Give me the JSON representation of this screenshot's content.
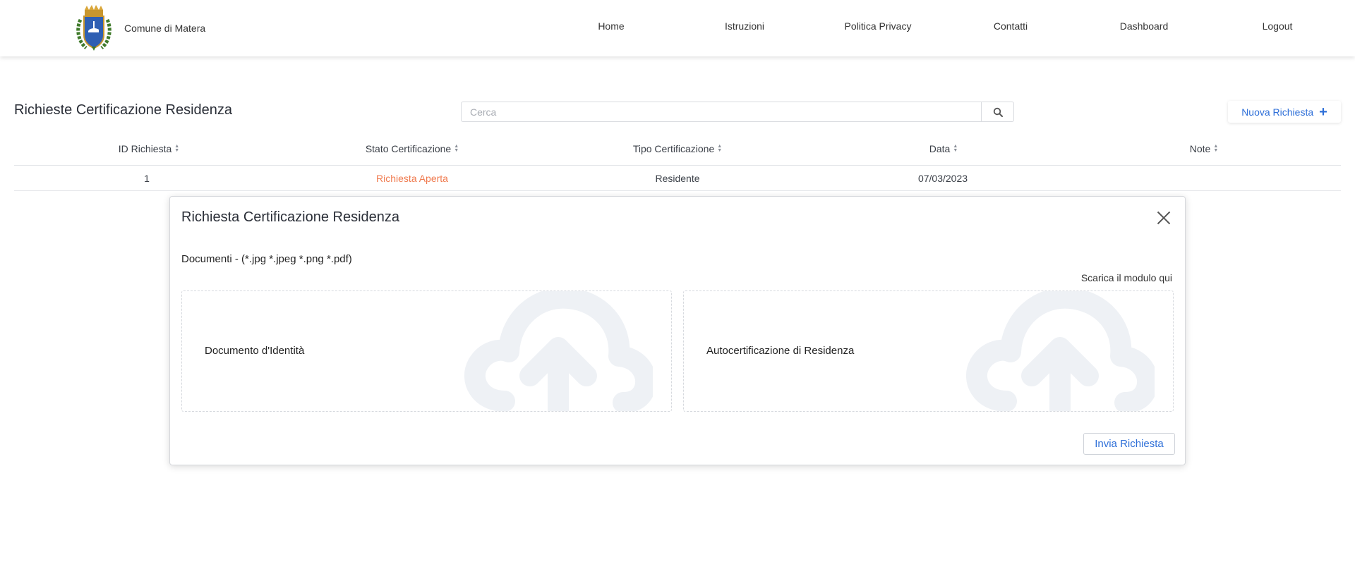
{
  "header": {
    "brand_name": "Comune di Matera",
    "logo_icon": "coat-of-arms-icon",
    "nav": [
      {
        "label": "Home"
      },
      {
        "label": "Istruzioni"
      },
      {
        "label": "Politica Privacy"
      },
      {
        "label": "Contatti"
      },
      {
        "label": "Dashboard"
      },
      {
        "label": "Logout"
      }
    ]
  },
  "toolbar": {
    "page_title": "Richieste Certificazione Residenza",
    "search_placeholder": "Cerca",
    "search_value": "",
    "search_icon": "search-icon",
    "new_request_label": "Nuova Richiesta",
    "new_request_icon": "plus-icon"
  },
  "table": {
    "columns": [
      "ID Richiesta",
      "Stato Certificazione",
      "Tipo Certificazione",
      "Data",
      "Note"
    ],
    "rows": [
      {
        "id": "1",
        "status": "Richiesta Aperta",
        "type": "Residente",
        "date": "07/03/2023",
        "note": ""
      }
    ]
  },
  "modal": {
    "title": "Richiesta Certificazione Residenza",
    "documents_label": "Documenti - (*.jpg *.jpeg *.png *.pdf)",
    "download_link": "Scarica il modulo qui",
    "dropzones": [
      {
        "label": "Documento d'Identità",
        "icon": "cloud-upload-icon"
      },
      {
        "label": "Autocertificazione di Residenza",
        "icon": "cloud-upload-icon"
      }
    ],
    "submit_label": "Invia Richiesta",
    "close_icon": "close-icon"
  },
  "colors": {
    "accent": "#2e6fd8",
    "status_open": "#f07a4e",
    "upload_icon": "#eef1f5"
  }
}
